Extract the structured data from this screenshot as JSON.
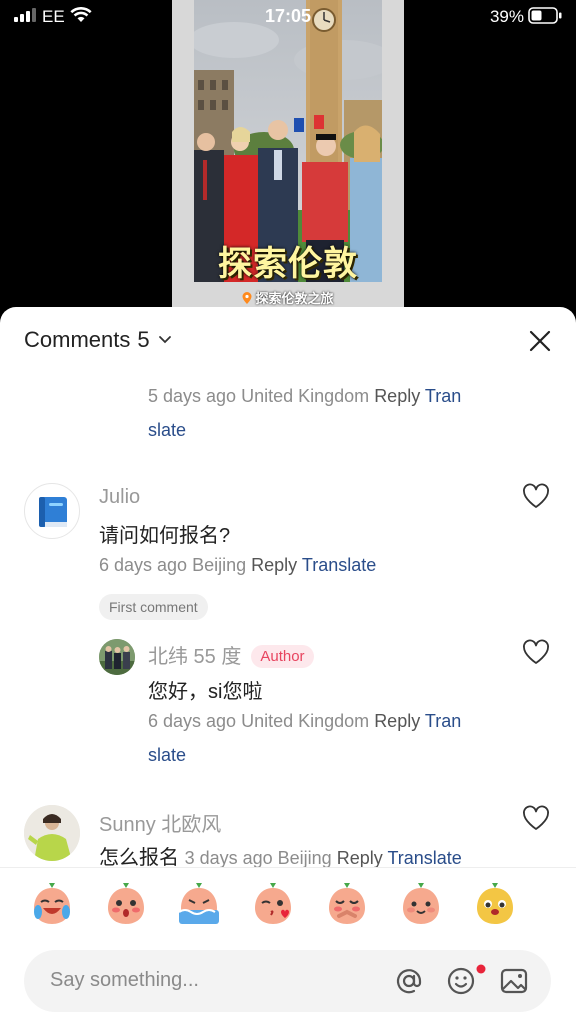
{
  "status_bar": {
    "carrier": "EE",
    "time": "17:05",
    "battery": "39%"
  },
  "video": {
    "caption": "探索伦敦",
    "tag": "探索伦敦之旅"
  },
  "sheet": {
    "title": "Comments",
    "count": "5"
  },
  "comments": {
    "prev_meta": {
      "time": "5 days ago",
      "location": "United Kingdom",
      "reply": "Reply",
      "translate_1": "Tran",
      "translate_2": "slate"
    },
    "julio": {
      "name": "Julio",
      "text": "请问如何报名?",
      "time": "6 days ago",
      "location": "Beijing",
      "reply": "Reply",
      "translate": "Translate",
      "badge": "First comment"
    },
    "author_reply": {
      "name": "北纬 55 度",
      "badge": "Author",
      "text": "您好，si您啦",
      "time": "6 days ago",
      "location": "United Kingdom",
      "reply": "Reply",
      "translate_1": "Tran",
      "translate_2": "slate"
    },
    "sunny": {
      "name": "Sunny 北欧风",
      "text": "怎么报名",
      "time": "3 days ago",
      "location": "Beijing",
      "reply": "Reply",
      "translate": "Translate"
    }
  },
  "emojis": [
    "crying-laughing-emoji",
    "shy-emoji",
    "swimming-emoji",
    "kiss-emoji",
    "pleading-emoji",
    "smile-emoji",
    "puppy-face-emoji"
  ],
  "input": {
    "placeholder": "Say something..."
  },
  "colors": {
    "link": "#2a4d8a",
    "author_badge": "#e8445f",
    "notification_dot": "#e8243a"
  }
}
